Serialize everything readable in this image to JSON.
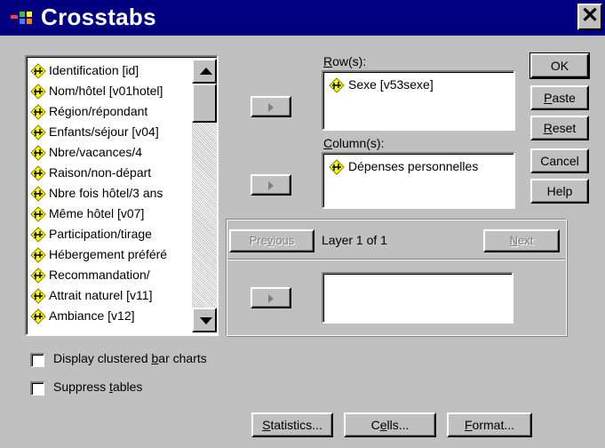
{
  "window": {
    "title": "Crosstabs",
    "close_label": "✕"
  },
  "variables": [
    "Identification [id]",
    "Nom/hôtel [v01hotel]",
    "Région/répondant",
    "Enfants/séjour [v04]",
    "Nbre/vacances/4",
    "Raison/non-départ",
    "Nbre fois hôtel/3 ans",
    "Même hôtel [v07]",
    "Participation/tirage",
    "Hébergement préféré",
    "Recommandation/",
    "Attrait naturel [v11]",
    "Ambiance [v12]"
  ],
  "rows": {
    "label_pre": "",
    "label_key": "R",
    "label_post": "ow(s):",
    "items": [
      "Sexe [v53sexe]"
    ]
  },
  "columns": {
    "label_pre": "",
    "label_key": "C",
    "label_post": "olumn(s):",
    "items": [
      "Dépenses personnelles"
    ]
  },
  "layer": {
    "previous_pre": "Pre",
    "previous_key": "v",
    "previous_post": "ious",
    "text": "Layer 1 of 1",
    "next_pre": "",
    "next_key": "N",
    "next_post": "ext"
  },
  "buttons": {
    "ok": "OK",
    "paste_key": "P",
    "paste_rest": "aste",
    "reset_key": "R",
    "reset_rest": "eset",
    "cancel": "Cancel",
    "help": "Help"
  },
  "options": {
    "clustered_pre": "Display clustered ",
    "clustered_key": "b",
    "clustered_post": "ar charts",
    "suppress_pre": "Suppress ",
    "suppress_key": "t",
    "suppress_post": "ables"
  },
  "bottom_buttons": {
    "statistics_key": "S",
    "statistics_rest": "tatistics...",
    "cells_pre": "C",
    "cells_key": "e",
    "cells_post": "lls...",
    "format_key": "F",
    "format_rest": "ormat..."
  },
  "icons": {
    "variable": "scale-variable-icon",
    "title": "spss-icon",
    "close": "close-icon"
  },
  "colors": {
    "titlebar": "#000080",
    "face": "#c0c0c0",
    "icon_yellow": "#ffff00"
  }
}
